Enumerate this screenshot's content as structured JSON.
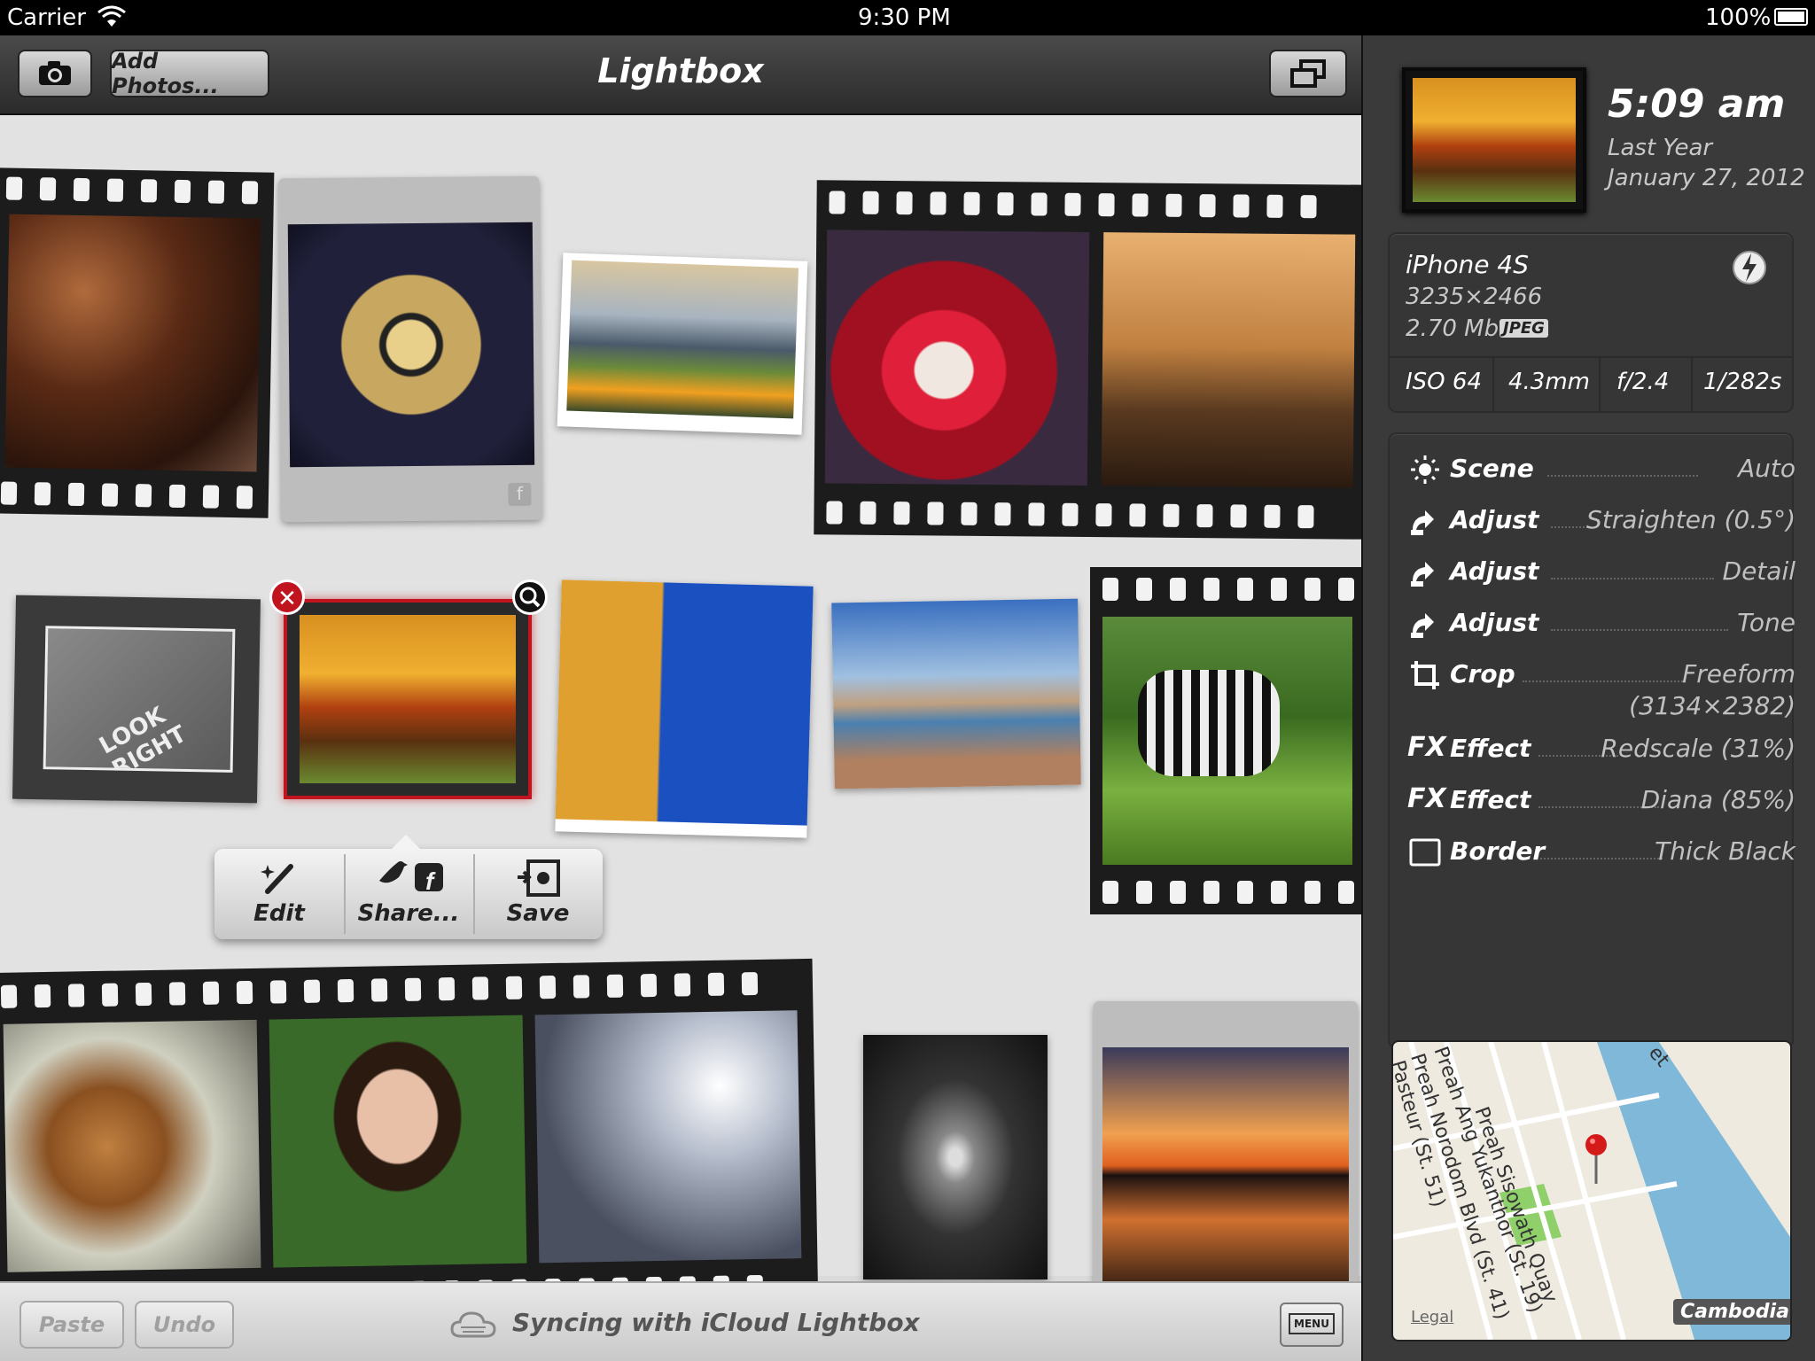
{
  "status_bar": {
    "carrier": "Carrier",
    "time": "9:30 PM",
    "battery": "100%"
  },
  "toolbar": {
    "camera_icon": "camera-icon",
    "add_photos": "Add Photos...",
    "title": "Lightbox",
    "windows_icon": "stacked-windows-icon"
  },
  "popup": {
    "edit": "Edit",
    "share": "Share...",
    "save": "Save"
  },
  "bottom_bar": {
    "paste": "Paste",
    "undo": "Undo",
    "sync": "Syncing with iCloud Lightbox",
    "menu": "MENU"
  },
  "details": {
    "time": "5:09 am",
    "relative_date": "Last Year",
    "date": "January 27, 2012",
    "device": "iPhone 4S",
    "dimensions": "3235×2466",
    "size": "2.70 Mb",
    "format": "JPEG",
    "iso": "ISO 64",
    "focal": "4.3mm",
    "aperture": "f/2.4",
    "shutter": "1/282s",
    "edits": [
      {
        "icon": "scene-icon",
        "label": "Scene",
        "value": "Auto",
        "value2": ""
      },
      {
        "icon": "adjust-icon",
        "label": "Adjust",
        "value": "Straighten (0.5°)",
        "value2": ""
      },
      {
        "icon": "adjust-icon",
        "label": "Adjust",
        "value": "Detail",
        "value2": ""
      },
      {
        "icon": "adjust-icon",
        "label": "Adjust",
        "value": "Tone",
        "value2": ""
      },
      {
        "icon": "crop-icon",
        "label": "Crop",
        "value": "Freeform",
        "value2": "(3134×2382)"
      },
      {
        "icon": "fx-icon",
        "label": "Effect",
        "value": "Redscale (31%)",
        "value2": ""
      },
      {
        "icon": "fx-icon",
        "label": "Effect",
        "value": "Diana (85%)",
        "value2": ""
      },
      {
        "icon": "border-icon",
        "label": "Border",
        "value": "Thick Black",
        "value2": ""
      }
    ],
    "fx_text": "FX"
  },
  "map": {
    "streets": [
      "Preah Sisowath Quay",
      "Preah Ang Yukanthor (St. 19)",
      "Preah Norodom Blvd (St. 41)",
      "Pasteur (St. 51)",
      "et"
    ],
    "legal": "Legal",
    "country": "Cambodia"
  },
  "colors": {
    "accent_red": "#c0151f",
    "panel": "#3a3a3a",
    "canvas": "#e2e2e2"
  }
}
